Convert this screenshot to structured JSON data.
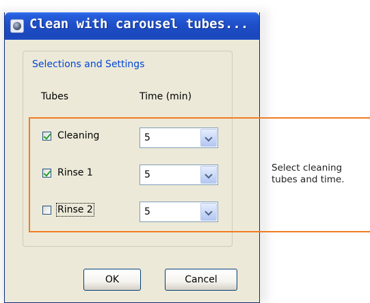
{
  "dialog": {
    "title": "Clean with carousel tubes...",
    "group_label": "Selections and Settings",
    "columns": {
      "tubes": "Tubes",
      "time": "Time (min)"
    },
    "rows": [
      {
        "label": "Cleaning",
        "checked": true,
        "time": "5"
      },
      {
        "label": "Rinse 1",
        "checked": true,
        "time": "5"
      },
      {
        "label": "Rinse 2",
        "checked": false,
        "time": "5",
        "focused": true
      }
    ],
    "buttons": {
      "ok": "OK",
      "cancel": "Cancel"
    }
  },
  "callout": {
    "text": "Select cleaning tubes and time.",
    "color": "#f07b22"
  },
  "colors": {
    "titlebar": "#1f4fc9",
    "group_label": "#0046d5",
    "window_bg": "#ece9d8"
  }
}
